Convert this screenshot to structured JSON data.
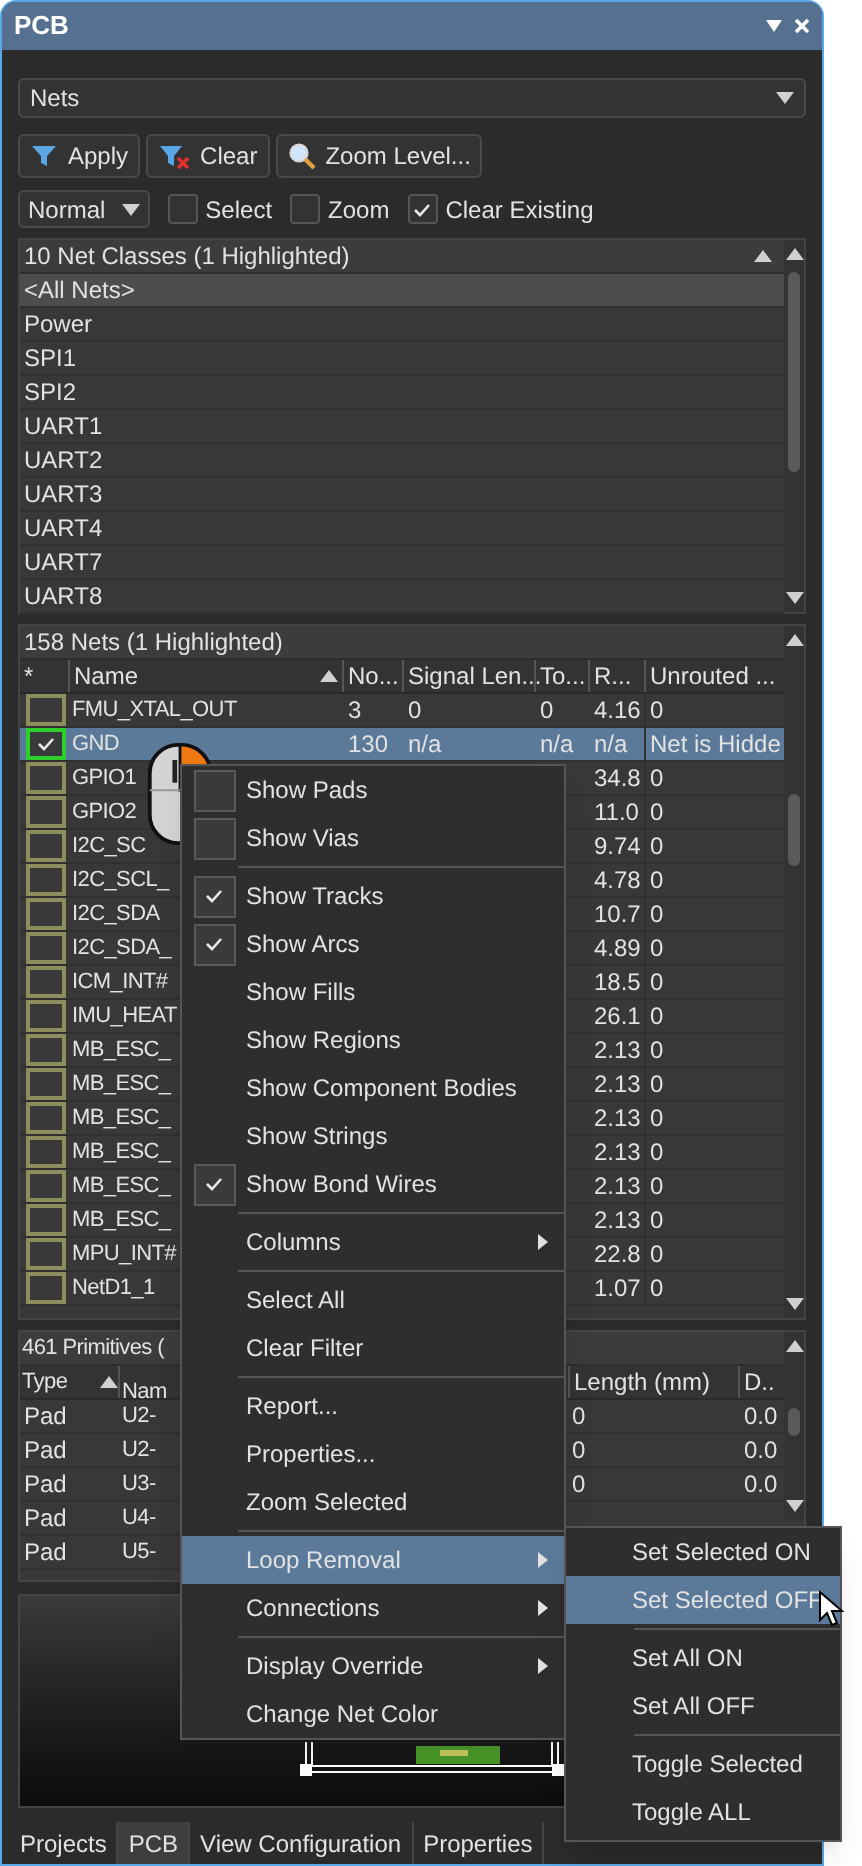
{
  "panel": {
    "title": "PCB"
  },
  "mode_dropdown": {
    "value": "Nets"
  },
  "toolbar": [
    {
      "label": "Apply",
      "kind": "apply"
    },
    {
      "label": "Clear",
      "kind": "clear"
    },
    {
      "label": "Zoom Level...",
      "kind": "zoom"
    }
  ],
  "options": {
    "highlight_mode": "Normal",
    "checks": [
      {
        "label": "Select",
        "checked": false
      },
      {
        "label": "Zoom",
        "checked": false
      },
      {
        "label": "Clear Existing",
        "checked": true
      }
    ]
  },
  "net_classes": {
    "header": "10 Net Classes (1 Highlighted)",
    "rows": [
      {
        "name": "<All Nets>",
        "selected": true
      },
      {
        "name": "Power",
        "selected": false
      },
      {
        "name": "SPI1",
        "selected": false
      },
      {
        "name": "SPI2",
        "selected": false
      },
      {
        "name": "UART1",
        "selected": false
      },
      {
        "name": "UART2",
        "selected": false
      },
      {
        "name": "UART3",
        "selected": false
      },
      {
        "name": "UART4",
        "selected": false
      },
      {
        "name": "UART7",
        "selected": false
      },
      {
        "name": "UART8",
        "selected": false
      }
    ]
  },
  "nets": {
    "header": "158 Nets (1 Highlighted)",
    "columns": [
      "*",
      "Name",
      "No...",
      "Signal Len...",
      "To...",
      "R...",
      "Unrouted ..."
    ],
    "rows": [
      {
        "name": "FMU_XTAL_OUT",
        "nodes": "3",
        "signal_length": "0",
        "total": "0",
        "routed": "4.16",
        "unrouted": "0",
        "checked": false,
        "selected": false
      },
      {
        "name": "GND",
        "nodes": "130",
        "signal_length": "n/a",
        "total": "n/a",
        "routed": "n/a",
        "unrouted": "Net is Hidde",
        "checked": true,
        "selected": true
      },
      {
        "name": "GPIO1",
        "routed": "34.8",
        "unrouted": "0",
        "checked": false,
        "selected": false
      },
      {
        "name": "GPIO2",
        "routed": "11.0",
        "unrouted": "0",
        "checked": false,
        "selected": false
      },
      {
        "name": "I2C_SC",
        "routed": "9.74",
        "unrouted": "0",
        "checked": false,
        "selected": false
      },
      {
        "name": "I2C_SCL_",
        "routed": "4.78",
        "unrouted": "0",
        "checked": false,
        "selected": false
      },
      {
        "name": "I2C_SDA",
        "routed": "10.7",
        "unrouted": "0",
        "checked": false,
        "selected": false
      },
      {
        "name": "I2C_SDA_",
        "routed": "4.89",
        "unrouted": "0",
        "checked": false,
        "selected": false
      },
      {
        "name": "ICM_INT#",
        "routed": "18.5",
        "unrouted": "0",
        "checked": false,
        "selected": false
      },
      {
        "name": "IMU_HEAT",
        "routed": "26.1",
        "unrouted": "0",
        "checked": false,
        "selected": false
      },
      {
        "name": "MB_ESC_",
        "routed": "2.13",
        "unrouted": "0",
        "checked": false,
        "selected": false
      },
      {
        "name": "MB_ESC_",
        "routed": "2.13",
        "unrouted": "0",
        "checked": false,
        "selected": false
      },
      {
        "name": "MB_ESC_",
        "routed": "2.13",
        "unrouted": "0",
        "checked": false,
        "selected": false
      },
      {
        "name": "MB_ESC_",
        "routed": "2.13",
        "unrouted": "0",
        "checked": false,
        "selected": false
      },
      {
        "name": "MB_ESC_",
        "routed": "2.13",
        "unrouted": "0",
        "checked": false,
        "selected": false
      },
      {
        "name": "MB_ESC_",
        "routed": "2.13",
        "unrouted": "0",
        "checked": false,
        "selected": false
      },
      {
        "name": "MPU_INT#",
        "routed": "22.8",
        "unrouted": "0",
        "checked": false,
        "selected": false
      },
      {
        "name": "NetD1_1",
        "routed": "1.07",
        "unrouted": "0",
        "checked": false,
        "selected": false
      }
    ]
  },
  "primitives": {
    "header": "461 Primitives (",
    "columns": [
      "Type",
      "Nam",
      "Length (mm)",
      "D.."
    ],
    "rows": [
      {
        "type": "Pad",
        "name": "U2-",
        "length": "0",
        "d": "0.0"
      },
      {
        "type": "Pad",
        "name": "U2-",
        "length": "0",
        "d": "0.0"
      },
      {
        "type": "Pad",
        "name": "U3-",
        "length": "0",
        "d": "0.0"
      },
      {
        "type": "Pad",
        "name": "U4-"
      },
      {
        "type": "Pad",
        "name": "U5-"
      }
    ]
  },
  "tabs": [
    {
      "label": "Projects",
      "selected": false
    },
    {
      "label": "PCB",
      "selected": true
    },
    {
      "label": "View Configuration",
      "selected": false
    },
    {
      "label": "Properties",
      "selected": false
    }
  ],
  "context_menu": [
    {
      "kind": "toggle",
      "label": "Show Pads",
      "checked": false
    },
    {
      "kind": "toggle",
      "label": "Show Vias",
      "checked": false
    },
    {
      "kind": "separator"
    },
    {
      "kind": "toggle",
      "label": "Show Tracks",
      "checked": true
    },
    {
      "kind": "toggle",
      "label": "Show Arcs",
      "checked": true
    },
    {
      "kind": "item",
      "label": "Show Fills"
    },
    {
      "kind": "item",
      "label": "Show Regions"
    },
    {
      "kind": "item",
      "label": "Show Component Bodies"
    },
    {
      "kind": "item",
      "label": "Show Strings"
    },
    {
      "kind": "toggle",
      "label": "Show Bond Wires",
      "checked": true
    },
    {
      "kind": "separator"
    },
    {
      "kind": "submenu",
      "label": "Columns",
      "selected": false
    },
    {
      "kind": "separator"
    },
    {
      "kind": "item",
      "label": "Select All"
    },
    {
      "kind": "item",
      "label": "Clear Filter"
    },
    {
      "kind": "separator"
    },
    {
      "kind": "item",
      "label": "Report..."
    },
    {
      "kind": "item",
      "label": "Properties..."
    },
    {
      "kind": "item",
      "label": "Zoom Selected"
    },
    {
      "kind": "separator"
    },
    {
      "kind": "submenu",
      "label": "Loop Removal",
      "selected": true
    },
    {
      "kind": "submenu",
      "label": "Connections",
      "selected": false
    },
    {
      "kind": "separator"
    },
    {
      "kind": "submenu",
      "label": "Display Override",
      "selected": false
    },
    {
      "kind": "item",
      "label": "Change Net Color"
    }
  ],
  "submenu": [
    {
      "kind": "item",
      "label": "Set Selected ON",
      "selected": false
    },
    {
      "kind": "item",
      "label": "Set Selected OFF",
      "selected": true
    },
    {
      "kind": "separator"
    },
    {
      "kind": "item",
      "label": "Set All ON",
      "selected": false
    },
    {
      "kind": "item",
      "label": "Set All OFF",
      "selected": false
    },
    {
      "kind": "separator"
    },
    {
      "kind": "item",
      "label": "Toggle Selected",
      "selected": false
    },
    {
      "kind": "item",
      "label": "Toggle ALL",
      "selected": false
    }
  ]
}
